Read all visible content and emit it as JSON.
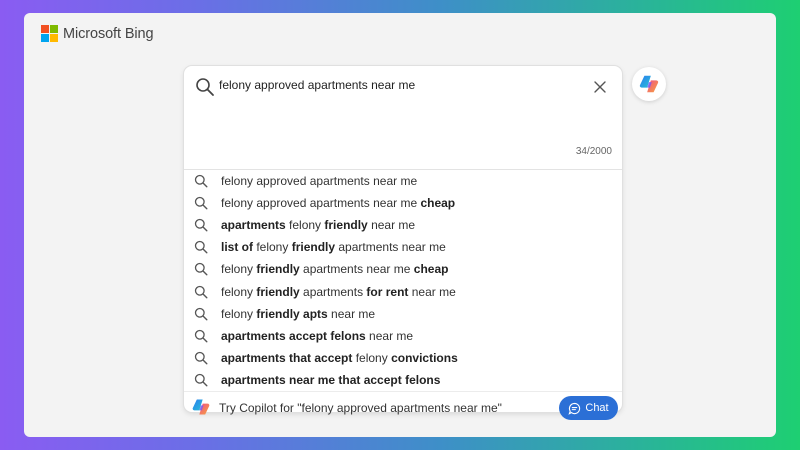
{
  "brand": {
    "name": "Microsoft Bing",
    "logo_colors": [
      "#f25022",
      "#7fba00",
      "#00a4ef",
      "#ffb900"
    ]
  },
  "search": {
    "query": "felony approved apartments near me",
    "char_count": "34/2000"
  },
  "suggestions": [
    [
      {
        "t": "felony approved apartments near me",
        "b": false
      }
    ],
    [
      {
        "t": "felony approved apartments near me ",
        "b": false
      },
      {
        "t": "cheap",
        "b": true
      }
    ],
    [
      {
        "t": "apartments",
        "b": true
      },
      {
        "t": " felony ",
        "b": false
      },
      {
        "t": "friendly",
        "b": true
      },
      {
        "t": " near me",
        "b": false
      }
    ],
    [
      {
        "t": "list of",
        "b": true
      },
      {
        "t": " felony ",
        "b": false
      },
      {
        "t": "friendly",
        "b": true
      },
      {
        "t": " apartments near me",
        "b": false
      }
    ],
    [
      {
        "t": "felony ",
        "b": false
      },
      {
        "t": "friendly",
        "b": true
      },
      {
        "t": " apartments near me ",
        "b": false
      },
      {
        "t": "cheap",
        "b": true
      }
    ],
    [
      {
        "t": "felony ",
        "b": false
      },
      {
        "t": "friendly",
        "b": true
      },
      {
        "t": " apartments ",
        "b": false
      },
      {
        "t": "for rent",
        "b": true
      },
      {
        "t": " near me",
        "b": false
      }
    ],
    [
      {
        "t": "felony ",
        "b": false
      },
      {
        "t": "friendly apts",
        "b": true
      },
      {
        "t": " near me",
        "b": false
      }
    ],
    [
      {
        "t": "apartments accept felons",
        "b": true
      },
      {
        "t": " near me",
        "b": false
      }
    ],
    [
      {
        "t": "apartments that accept",
        "b": true
      },
      {
        "t": " felony ",
        "b": false
      },
      {
        "t": "convictions",
        "b": true
      }
    ],
    [
      {
        "t": "apartments near me that accept felons",
        "b": true
      }
    ]
  ],
  "copilot": {
    "prompt": "Try Copilot for \"felony approved apartments near me\"",
    "chat_label": "Chat",
    "accent": "#2b6fd6"
  },
  "icons": {
    "search": "search-icon",
    "clear": "close-icon",
    "copilot": "copilot-icon",
    "chat": "chat-bubble-icon"
  }
}
